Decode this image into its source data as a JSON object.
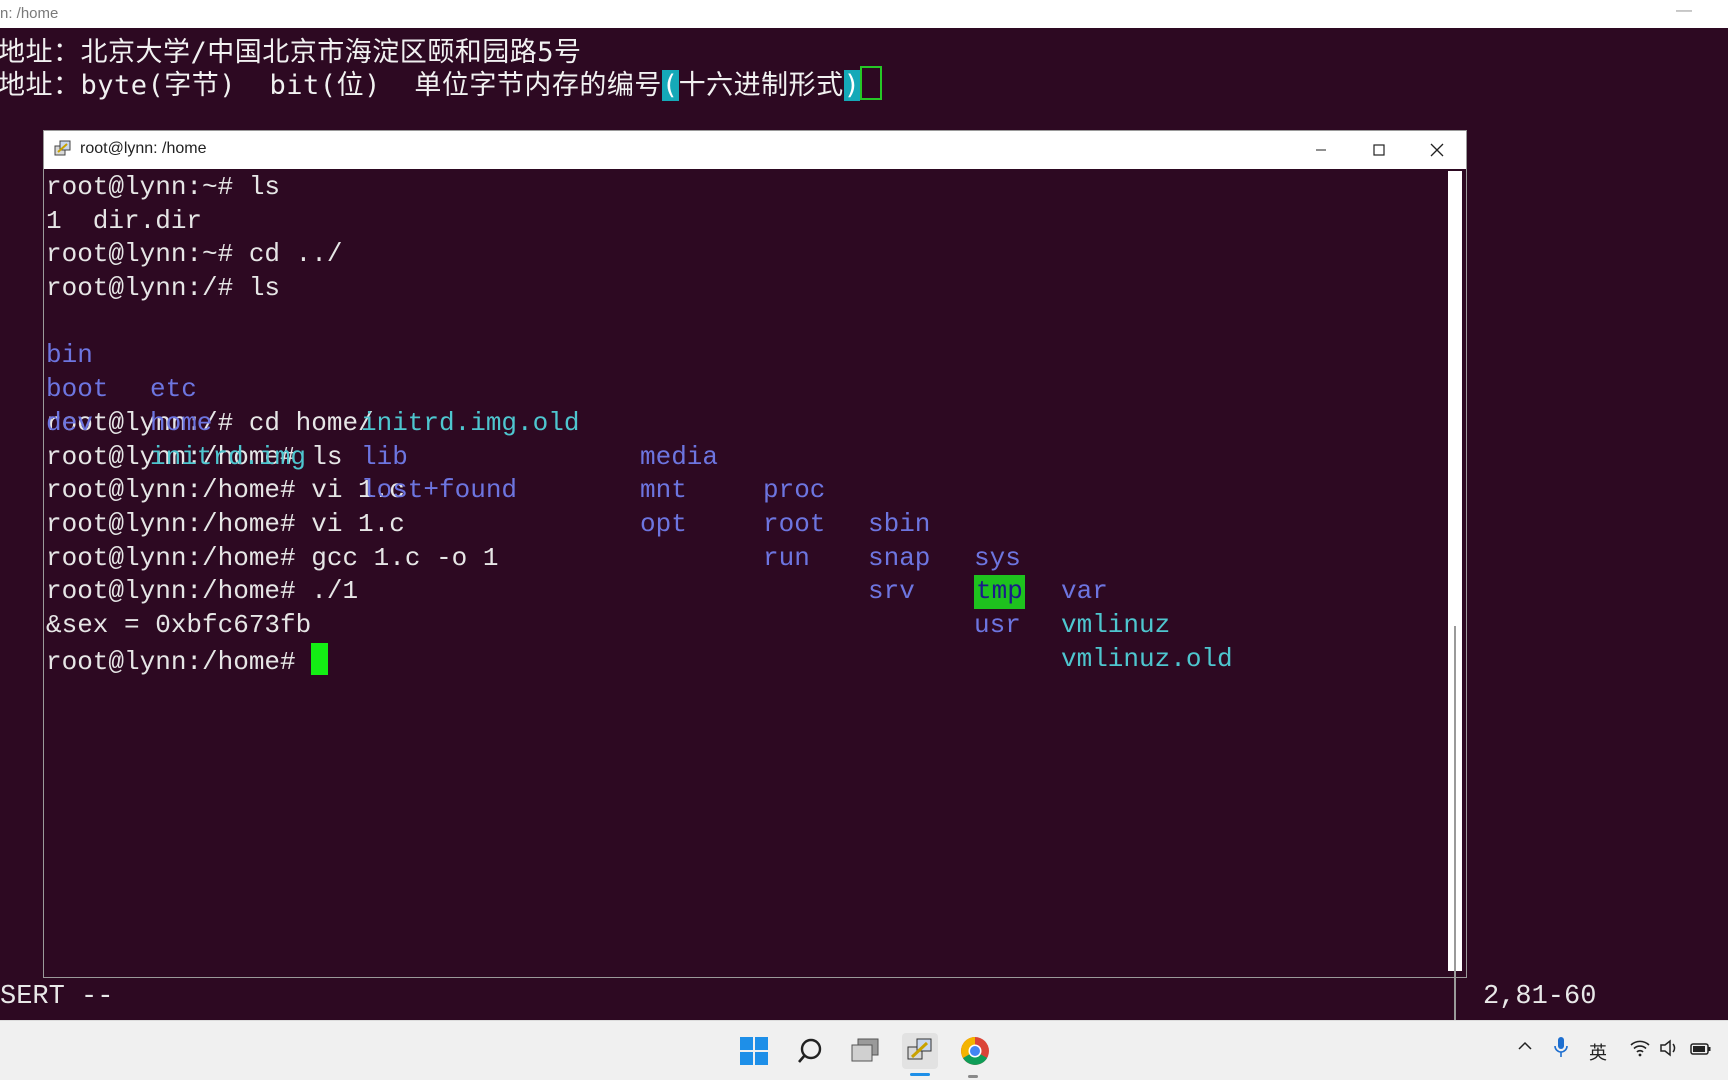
{
  "background": {
    "title": "n: /home",
    "line1": "地址：北京大学/中国北京市海淀区颐和园路5号",
    "line2_pre": "地址：byte(字节)  bit(位)  单位字节内存的编号",
    "line2_open": "(",
    "line2_mid": "十六进制形式",
    "line2_close": ")",
    "status_mode": "SERT --",
    "status_pos": "2,81-60"
  },
  "window": {
    "title": "root@lynn: /home",
    "icon": "putty-icon",
    "minimize_icon": "minimize-icon",
    "maximize_icon": "maximize-icon",
    "close_icon": "close-icon"
  },
  "terminal": {
    "l1": "root@lynn:~# ls",
    "l2": "1  dir.dir",
    "l3": "root@lynn:~# cd ../",
    "l4": "root@lynn:/# ls",
    "ls_row1": [
      "bin",
      "etc",
      "initrd.img.old",
      "media",
      "proc",
      "sbin",
      "sys",
      "var"
    ],
    "ls_row2": [
      "boot",
      "home",
      "lib",
      "mnt",
      "root",
      "snap",
      "tmp",
      "vmlinuz"
    ],
    "ls_row3": [
      "dev",
      "initrd.img",
      "lost+found",
      "opt",
      "run",
      "srv",
      "usr",
      "vmlinuz.old"
    ],
    "l8": "root@lynn:/# cd home/",
    "l9": "root@lynn:/home# ls",
    "l10": "root@lynn:/home# vi 1.c",
    "l11": "root@lynn:/home# vi 1.c",
    "l12": "root@lynn:/home# gcc 1.c -o 1",
    "l13": "root@lynn:/home# ./1",
    "l14": "&sex = 0xbfc673fb",
    "l15": "root@lynn:/home# "
  },
  "taskbar": {
    "items": [
      "windows-start-icon",
      "search-icon",
      "task-view-icon",
      "putty-icon",
      "chrome-icon"
    ],
    "tray_ime": "英",
    "tray_icons": [
      "chevron-up-icon",
      "microphone-icon",
      "wifi-icon",
      "volume-icon",
      "battery-icon"
    ]
  }
}
